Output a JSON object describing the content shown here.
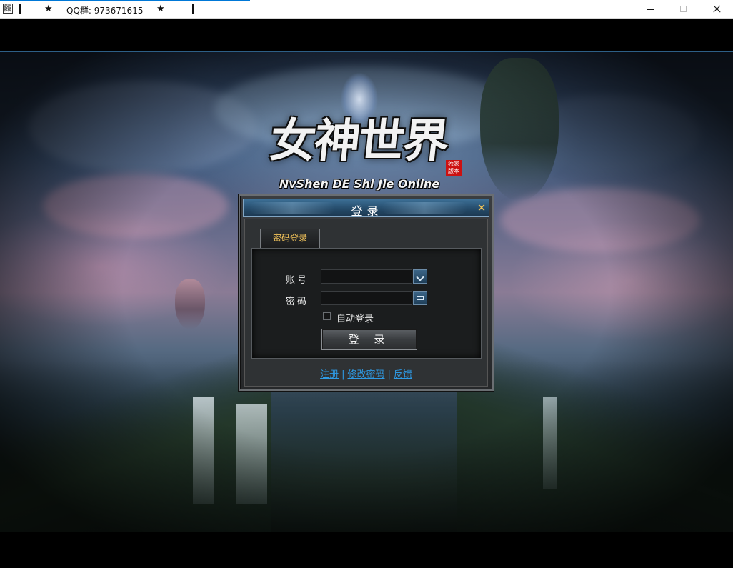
{
  "window": {
    "qq_text": "QQ群: 973671615",
    "star": "★",
    "icon_glyph": "龖"
  },
  "logo": {
    "title": "女神世界",
    "subtitle": "NvShen DE Shi Jie Online",
    "seal": "独家版本"
  },
  "dialog": {
    "title": "登录",
    "close_glyph": "✕",
    "tab_label": "密码登录",
    "account_label": "账号",
    "account_value": "",
    "password_label": "密码",
    "password_value": "",
    "auto_login_label": "自动登录",
    "login_button": "登 录",
    "links": [
      "注册",
      "修改密码",
      "反馈"
    ],
    "link_separator": "|"
  },
  "colors": {
    "accent_gold": "#f2c35a",
    "link_blue": "#2e9be6",
    "header_blue": "#2a5577"
  }
}
